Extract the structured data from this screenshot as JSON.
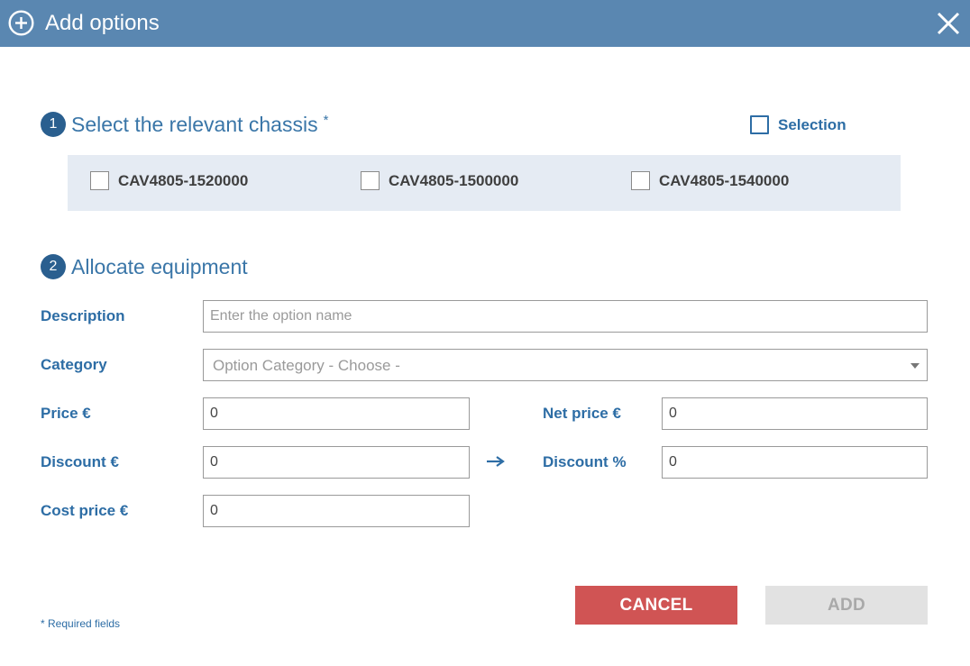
{
  "header": {
    "title": "Add options",
    "add_icon": "plus-circle-icon",
    "close_icon": "close-icon"
  },
  "section1": {
    "number": "1",
    "title": "Select the relevant chassis",
    "required_marker": "*",
    "selection_label": "Selection",
    "chassis": [
      {
        "label": "CAV4805-1520000",
        "checked": false
      },
      {
        "label": "CAV4805-1500000",
        "checked": false
      },
      {
        "label": "CAV4805-1540000",
        "checked": false
      }
    ]
  },
  "section2": {
    "number": "2",
    "title": "Allocate equipment",
    "description": {
      "label": "Description",
      "placeholder": "Enter the option name",
      "value": ""
    },
    "category": {
      "label": "Category",
      "value": "Option Category - Choose -"
    },
    "price": {
      "label": "Price €",
      "value": "0"
    },
    "net_price": {
      "label": "Net price €",
      "value": "0"
    },
    "discount": {
      "label": "Discount €",
      "value": "0"
    },
    "discount_pct": {
      "label": "Discount %",
      "value": "0"
    },
    "cost_price": {
      "label": "Cost price €",
      "value": "0"
    },
    "arrow_icon": "arrow-right-icon"
  },
  "footer": {
    "required_note": "* Required fields",
    "cancel_label": "CANCEL",
    "add_label": "ADD"
  },
  "colors": {
    "header_bg": "#5a87b1",
    "accent_blue": "#2d6da5",
    "step_badge": "#2a5f8f",
    "chassis_panel_bg": "#e5ebf3",
    "cancel_bg": "#d05454",
    "add_disabled_bg": "#e2e2e2"
  }
}
